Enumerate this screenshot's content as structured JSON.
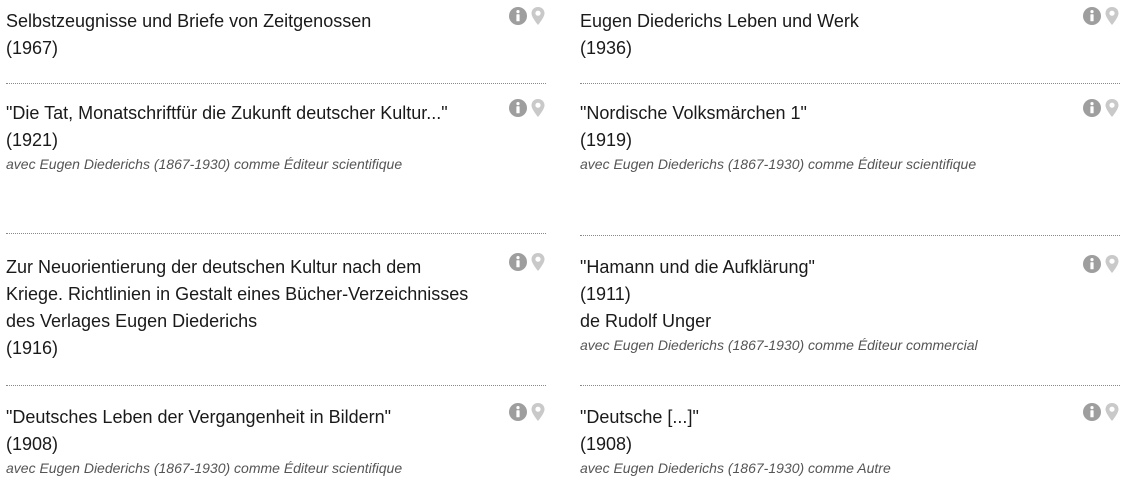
{
  "colors": {
    "info_icon": "#9e9e9e",
    "pin_icon": "#c9c9c9",
    "divider": "#7a8aa8",
    "note_text": "#555555"
  },
  "left": [
    {
      "title": "Selbstzeugnisse und Briefe von Zeitgenossen",
      "year": "(1967)",
      "author": "",
      "role": ""
    },
    {
      "title": "\"Die Tat, Monatschriftfür die Zukunft deutscher Kultur...\"",
      "year": "(1921)",
      "author": "",
      "role": "avec Eugen Diederichs (1867-1930) comme Éditeur scientifique"
    },
    {
      "title": "Zur Neuorientierung der deutschen Kultur nach dem Kriege. Richtlinien in Gestalt eines Bücher-Verzeichnisses des Verlages Eugen Diederichs",
      "year": "(1916)",
      "author": "",
      "role": ""
    },
    {
      "title": "\"Deutsches Leben der Vergangenheit in Bildern\"",
      "year": "(1908)",
      "author": "",
      "role": "avec Eugen Diederichs (1867-1930) comme Éditeur scientifique"
    }
  ],
  "right": [
    {
      "title": "Eugen Diederichs Leben und Werk",
      "year": "(1936)",
      "author": "",
      "role": ""
    },
    {
      "title": "\"Nordische Volksmärchen 1\"",
      "year": "(1919)",
      "author": "",
      "role": "avec Eugen Diederichs (1867-1930) comme Éditeur scientifique"
    },
    {
      "title": "\"Hamann und die Aufklärung\"",
      "year": "(1911)",
      "author": "de Rudolf Unger",
      "role": "avec Eugen Diederichs (1867-1930) comme Éditeur commercial"
    },
    {
      "title": "\"Deutsche [...]\"",
      "year": "(1908)",
      "author": "",
      "role": "avec Eugen Diederichs (1867-1930) comme Autre"
    }
  ]
}
